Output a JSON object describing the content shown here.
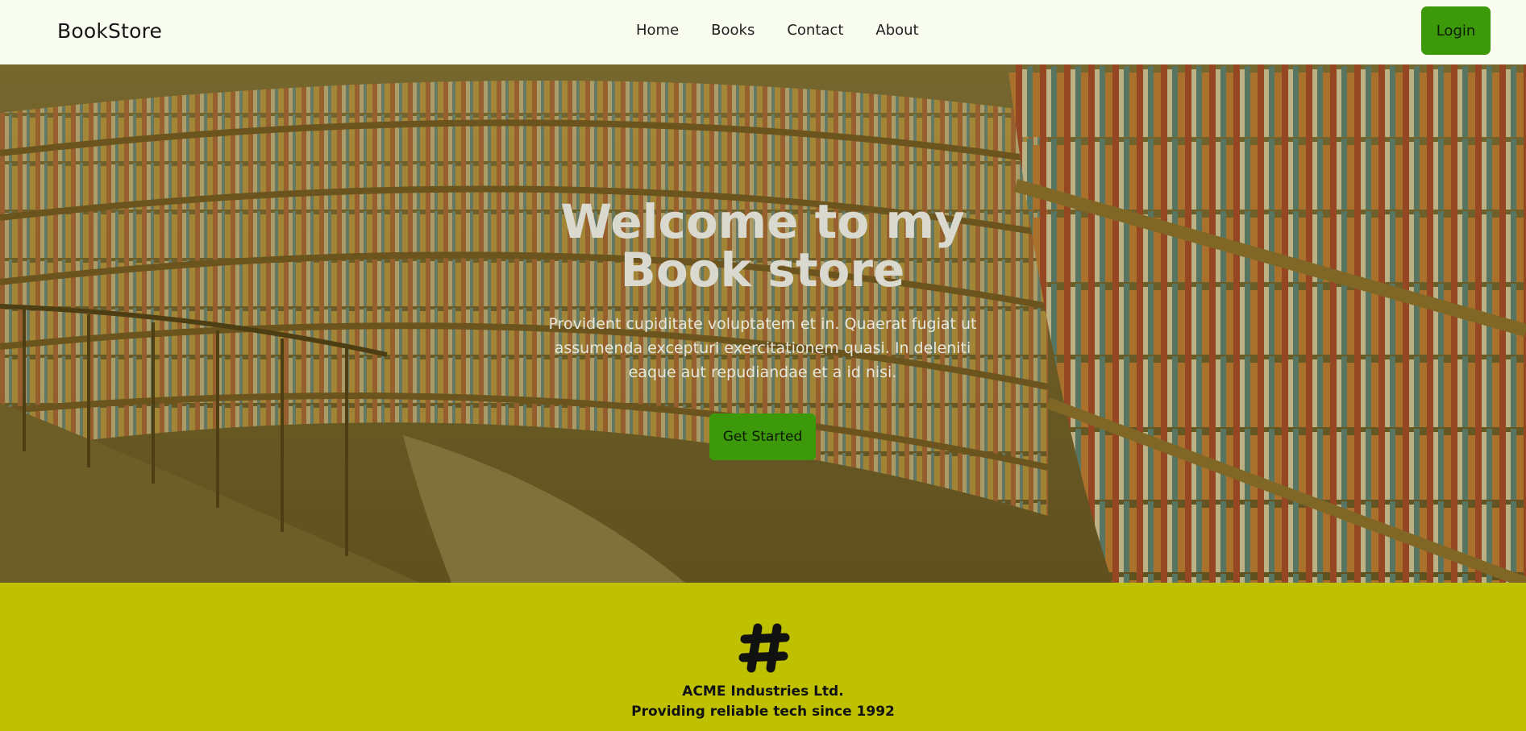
{
  "navbar": {
    "brand": "BookStore",
    "links": [
      "Home",
      "Books",
      "Contact",
      "About"
    ],
    "login_label": "Login"
  },
  "hero": {
    "title": "Welcome to my Book store",
    "description": "Provident cupiditate voluptatem et in. Quaerat fugiat ut assumenda excepturi exercitationem quasi. In deleniti eaque aut repudiandae et a id nisi.",
    "cta_label": "Get Started"
  },
  "footer": {
    "logo_icon": "hashtag-icon",
    "company": "ACME Industries Ltd.",
    "tagline": "Providing reliable tech since 1992"
  },
  "colors": {
    "nav_bg": "#f9fdf0",
    "accent_green": "#3c9a0a",
    "footer_bg": "#bfc000"
  }
}
